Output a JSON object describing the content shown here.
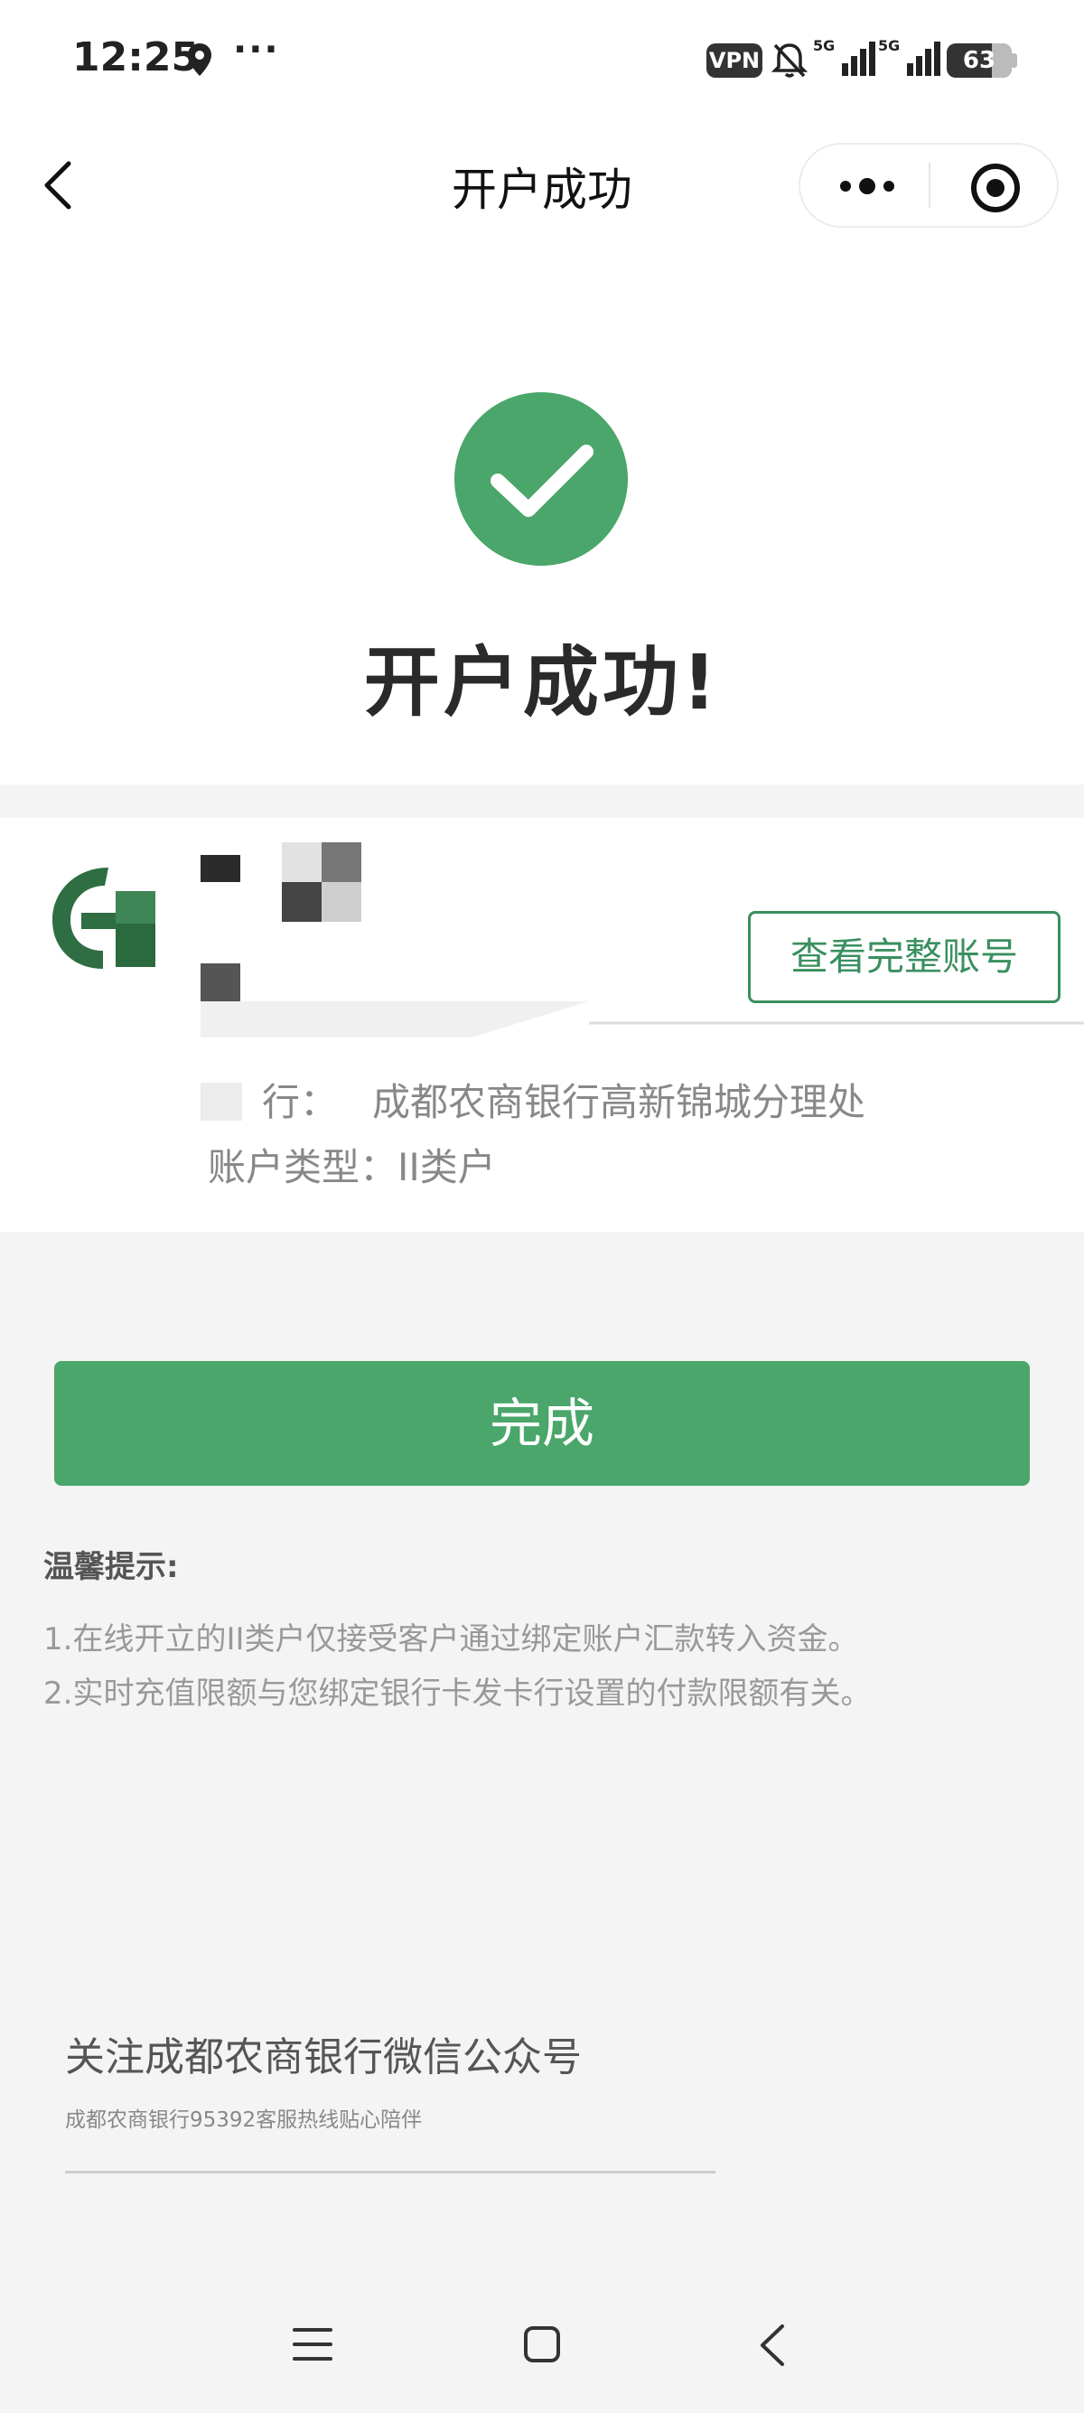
{
  "status_bar": {
    "time": "12:25",
    "more": "···",
    "vpn_label": "VPN",
    "network_1": "5G",
    "network_2": "5G",
    "battery_level": "63",
    "icons": [
      "location-icon",
      "bell-muted-icon",
      "signal-icon",
      "signal-icon",
      "battery-icon"
    ]
  },
  "nav": {
    "title": "开户成功",
    "icons": [
      "back-chevron-icon",
      "more-dots-icon",
      "close-target-icon"
    ]
  },
  "success": {
    "title": "开户成功!",
    "accent_color": "#4aa66a"
  },
  "account": {
    "view_full_label": "查看完整账号",
    "branch_value": "成都农商银行高新锦城分理处",
    "type_label": "账户类型：II类户"
  },
  "actions": {
    "done_label": "完成"
  },
  "tips": {
    "title": "温馨提示:",
    "items": [
      "1.在线开立的II类户仅接受客户通过绑定账户汇款转入资金。",
      "2.实时充值限额与您绑定银行卡发卡行设置的付款限额有关。"
    ]
  },
  "follow": {
    "title": "关注成都农商银行微信公众号",
    "subtitle": "成都农商银行95392客服热线贴心陪伴"
  },
  "system_nav": {
    "icons": [
      "menu-icon",
      "home-icon",
      "back-icon"
    ]
  }
}
